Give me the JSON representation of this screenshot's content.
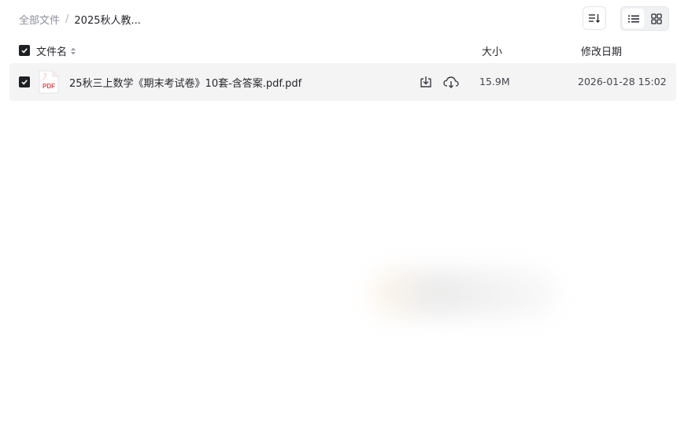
{
  "breadcrumb": {
    "root": "全部文件",
    "separator": "/",
    "current": "2025秋人教..."
  },
  "toolbar": {
    "sort_icon": "sort-icon",
    "view_list_icon": "list-view-icon",
    "view_grid_icon": "grid-view-icon",
    "active_view": "list"
  },
  "table": {
    "columns": {
      "name": "文件名",
      "size": "大小",
      "modified": "修改日期"
    },
    "rows": [
      {
        "checked": true,
        "icon": "pdf-file-icon",
        "icon_label": "PDF",
        "name": "25秋三上数学《期末考试卷》10套-含答案.pdf.pdf",
        "size": "15.9M",
        "modified": "2026-01-28 15:02"
      }
    ]
  },
  "colors": {
    "checkbox": "#1f2024",
    "row_background": "#f4f4f5",
    "pdf_red": "#e5484d"
  }
}
